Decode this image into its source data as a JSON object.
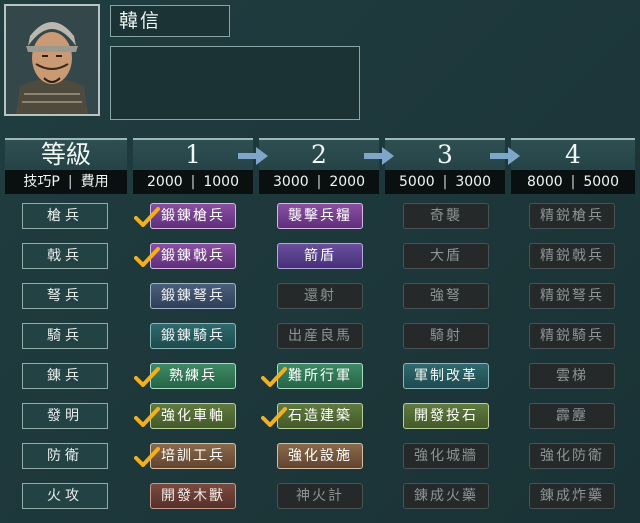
{
  "general": {
    "name": "韓信"
  },
  "header": {
    "title": "等級",
    "subtitle": [
      "技巧P",
      "費用"
    ],
    "levels": [
      {
        "level": "1",
        "tp": "2000",
        "cost": "1000"
      },
      {
        "level": "2",
        "tp": "3000",
        "cost": "2000"
      },
      {
        "level": "3",
        "tp": "5000",
        "cost": "3000"
      },
      {
        "level": "4",
        "tp": "8000",
        "cost": "5000"
      }
    ]
  },
  "rows": [
    {
      "label": "槍兵",
      "skills": [
        {
          "name": "鍛錬槍兵",
          "learned": true,
          "color": "purple"
        },
        {
          "name": "襲擊兵糧",
          "learned": false,
          "color": "purple"
        },
        {
          "name": "奇襲",
          "learned": false,
          "color": "dark"
        },
        {
          "name": "精鋭槍兵",
          "learned": false,
          "color": "dark"
        }
      ]
    },
    {
      "label": "戟兵",
      "skills": [
        {
          "name": "鍛錬戟兵",
          "learned": true,
          "color": "purple"
        },
        {
          "name": "箭盾",
          "learned": false,
          "color": "violet"
        },
        {
          "name": "大盾",
          "learned": false,
          "color": "dark"
        },
        {
          "name": "精鋭戟兵",
          "learned": false,
          "color": "dark"
        }
      ]
    },
    {
      "label": "弩兵",
      "skills": [
        {
          "name": "鍛錬弩兵",
          "learned": false,
          "color": "slate"
        },
        {
          "name": "還射",
          "learned": false,
          "color": "dark"
        },
        {
          "name": "強弩",
          "learned": false,
          "color": "dark"
        },
        {
          "name": "精鋭弩兵",
          "learned": false,
          "color": "dark"
        }
      ]
    },
    {
      "label": "騎兵",
      "skills": [
        {
          "name": "鍛錬騎兵",
          "learned": false,
          "color": "teal"
        },
        {
          "name": "出産良馬",
          "learned": false,
          "color": "dark"
        },
        {
          "name": "騎射",
          "learned": false,
          "color": "dark"
        },
        {
          "name": "精鋭騎兵",
          "learned": false,
          "color": "dark"
        }
      ]
    },
    {
      "label": "錬兵",
      "skills": [
        {
          "name": "熟練兵",
          "learned": true,
          "color": "green"
        },
        {
          "name": "難所行軍",
          "learned": true,
          "color": "green"
        },
        {
          "name": "軍制改革",
          "learned": false,
          "color": "teal"
        },
        {
          "name": "雲梯",
          "learned": false,
          "color": "dark"
        }
      ]
    },
    {
      "label": "發明",
      "skills": [
        {
          "name": "強化車軸",
          "learned": true,
          "color": "olive"
        },
        {
          "name": "石造建築",
          "learned": true,
          "color": "olive"
        },
        {
          "name": "開發投石",
          "learned": false,
          "color": "olive"
        },
        {
          "name": "霹靂",
          "learned": false,
          "color": "dark"
        }
      ]
    },
    {
      "label": "防衛",
      "skills": [
        {
          "name": "培訓工兵",
          "learned": true,
          "color": "brown"
        },
        {
          "name": "強化設施",
          "learned": false,
          "color": "brown"
        },
        {
          "name": "強化城牆",
          "learned": false,
          "color": "dark"
        },
        {
          "name": "強化防衛",
          "learned": false,
          "color": "dark"
        }
      ]
    },
    {
      "label": "火攻",
      "skills": [
        {
          "name": "開發木獸",
          "learned": false,
          "color": "rust"
        },
        {
          "name": "神火計",
          "learned": false,
          "color": "dark"
        },
        {
          "name": "錬成火藥",
          "learned": false,
          "color": "dark"
        },
        {
          "name": "錬成炸藥",
          "learned": false,
          "color": "dark"
        }
      ]
    }
  ],
  "icons": {
    "check": "checkmark-icon",
    "arrow": "right-arrow-icon"
  },
  "colors": {
    "check": "#f2b01e",
    "arrow": "#7da6c8",
    "background": "#1f3a3d"
  }
}
